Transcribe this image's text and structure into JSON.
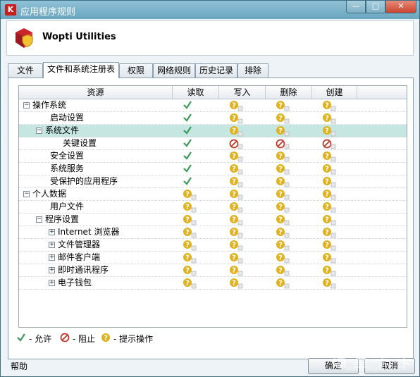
{
  "window": {
    "title": "应用程序规则",
    "app_icon_letter": "K",
    "controls": {
      "minimize": "—",
      "maximize": "□",
      "close": "✕"
    }
  },
  "header": {
    "app_name": "Wopti Utilities"
  },
  "tabs": [
    {
      "label": "文件",
      "active": false
    },
    {
      "label": "文件和系统注册表",
      "active": true
    },
    {
      "label": "权限",
      "active": false
    },
    {
      "label": "网络规则",
      "active": false
    },
    {
      "label": "历史记录",
      "active": false
    },
    {
      "label": "排除",
      "active": false
    }
  ],
  "grid": {
    "columns": [
      "资源",
      "读取",
      "写入",
      "删除",
      "创建"
    ],
    "rows": [
      {
        "label": "操作系统",
        "indent": 0,
        "expander": "−",
        "selected": false,
        "perms": [
          "allow",
          "prompt",
          "prompt",
          "prompt"
        ]
      },
      {
        "label": "启动设置",
        "indent": 2,
        "expander": "",
        "selected": false,
        "perms": [
          "allow",
          "prompt",
          "prompt",
          "prompt"
        ]
      },
      {
        "label": "系统文件",
        "indent": 1,
        "expander": "−",
        "selected": true,
        "perms": [
          "allow",
          "prompt",
          "prompt",
          "prompt"
        ]
      },
      {
        "label": "关键设置",
        "indent": 3,
        "expander": "",
        "selected": false,
        "perms": [
          "allow",
          "block",
          "block",
          "block"
        ]
      },
      {
        "label": "安全设置",
        "indent": 2,
        "expander": "",
        "selected": false,
        "perms": [
          "allow",
          "prompt",
          "prompt",
          "prompt"
        ]
      },
      {
        "label": "系统服务",
        "indent": 2,
        "expander": "",
        "selected": false,
        "perms": [
          "allow",
          "prompt",
          "prompt",
          "prompt"
        ]
      },
      {
        "label": "受保护的应用程序",
        "indent": 2,
        "expander": "",
        "selected": false,
        "perms": [
          "allow",
          "prompt",
          "prompt",
          "prompt"
        ]
      },
      {
        "label": "个人数据",
        "indent": 0,
        "expander": "−",
        "selected": false,
        "perms": [
          "prompt",
          "prompt",
          "prompt",
          "prompt"
        ]
      },
      {
        "label": "用户文件",
        "indent": 2,
        "expander": "",
        "selected": false,
        "perms": [
          "prompt",
          "prompt",
          "prompt",
          "prompt"
        ]
      },
      {
        "label": "程序设置",
        "indent": 1,
        "expander": "−",
        "selected": false,
        "perms": [
          "prompt",
          "prompt",
          "prompt",
          "prompt"
        ]
      },
      {
        "label": "Internet 浏览器",
        "indent": 2,
        "expander": "+",
        "selected": false,
        "perms": [
          "prompt",
          "prompt",
          "prompt",
          "prompt"
        ]
      },
      {
        "label": "文件管理器",
        "indent": 2,
        "expander": "+",
        "selected": false,
        "perms": [
          "prompt",
          "prompt",
          "prompt",
          "prompt"
        ]
      },
      {
        "label": "邮件客户端",
        "indent": 2,
        "expander": "+",
        "selected": false,
        "perms": [
          "prompt",
          "prompt",
          "prompt",
          "prompt"
        ]
      },
      {
        "label": "即时通讯程序",
        "indent": 2,
        "expander": "+",
        "selected": false,
        "perms": [
          "prompt",
          "prompt",
          "prompt",
          "prompt"
        ]
      },
      {
        "label": "电子钱包",
        "indent": 2,
        "expander": "+",
        "selected": false,
        "perms": [
          "prompt",
          "prompt",
          "prompt",
          "prompt"
        ]
      }
    ]
  },
  "legend": {
    "allow": "- 允许",
    "block": "- 阻止",
    "prompt": "- 提示操作"
  },
  "footer": {
    "help": "帮助",
    "ok": "确定",
    "cancel": "取消"
  },
  "watermark": {
    "main": "瑞 星 卡 卡",
    "sub": "www.ikaka.com"
  },
  "colors": {
    "allow": "#3a9a5c",
    "block": "#c0392b",
    "prompt": "#e0b21f",
    "selected_row": "#c6e6e1"
  }
}
